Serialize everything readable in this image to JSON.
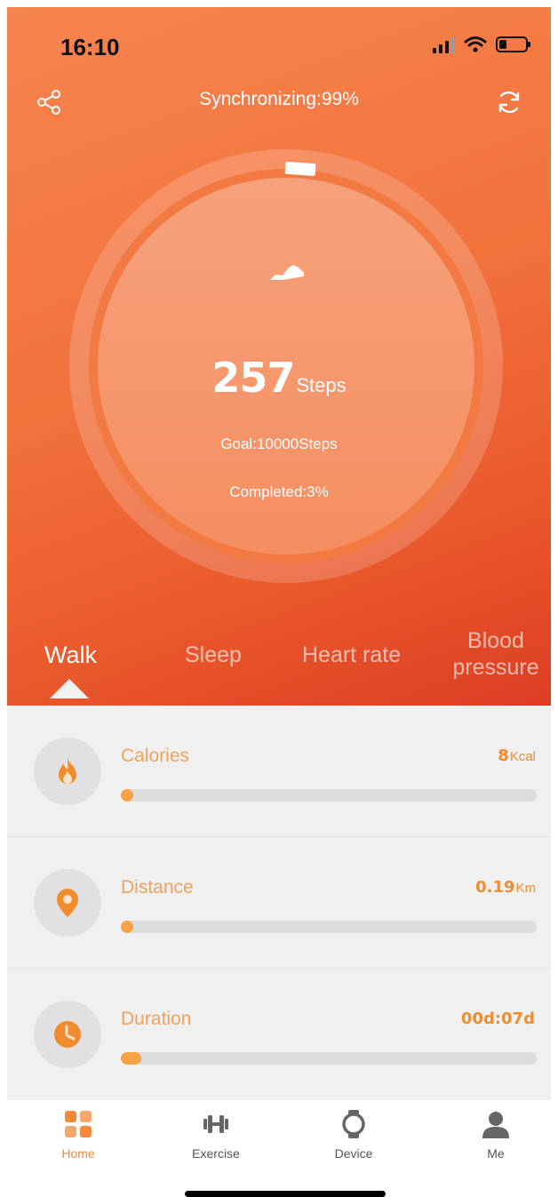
{
  "status": {
    "time": "16:10"
  },
  "header": {
    "title": "Synchronizing:99%"
  },
  "summary": {
    "steps_value": "257",
    "steps_unit": "Steps",
    "goal": "Goal:10000Steps",
    "completed": "Completed:3%",
    "progress_fraction": 0.03
  },
  "tabs": [
    {
      "label": "Walk",
      "active": true
    },
    {
      "label": "Sleep",
      "active": false
    },
    {
      "label": "Heart rate",
      "active": false
    },
    {
      "label": "Blood pressure",
      "active": false
    }
  ],
  "metrics": [
    {
      "label": "Calories",
      "value": "8",
      "unit": "Kcal",
      "progress_fraction": 0.02,
      "icon": "flame-icon"
    },
    {
      "label": "Distance",
      "value": "0.19",
      "unit": "Km",
      "progress_fraction": 0.02,
      "icon": "location-pin-icon"
    },
    {
      "label": "Duration",
      "value": "00d:07d",
      "unit": "",
      "progress_fraction": 0.05,
      "icon": "clock-icon"
    }
  ],
  "tabbar": [
    {
      "label": "Home",
      "active": true,
      "icon": "home-grid-icon"
    },
    {
      "label": "Exercise",
      "active": false,
      "icon": "dumbbell-icon"
    },
    {
      "label": "Device",
      "active": false,
      "icon": "watch-icon"
    },
    {
      "label": "Me",
      "active": false,
      "icon": "person-icon"
    }
  ],
  "colors": {
    "accent": "#f28a3b",
    "header_start": "#f6844f",
    "header_end": "#dd3d24",
    "metric_text": "#f0a25a",
    "bar_fill": "#f6a347"
  }
}
